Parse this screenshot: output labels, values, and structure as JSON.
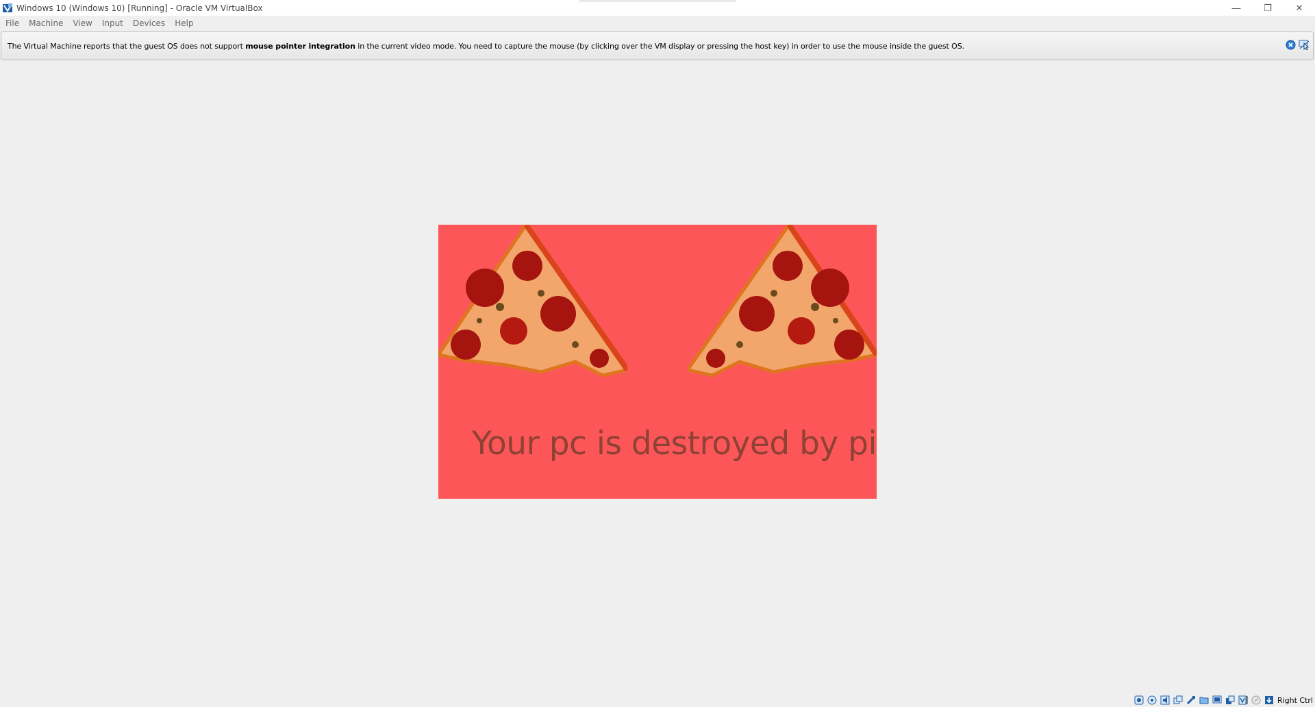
{
  "window": {
    "title": "Windows 10 (Windows 10) [Running] - Oracle VM VirtualBox",
    "minimize_glyph": "—",
    "restore_glyph": "❐",
    "close_glyph": "✕"
  },
  "menu": {
    "items": [
      "File",
      "Machine",
      "View",
      "Input",
      "Devices",
      "Help"
    ]
  },
  "notice": {
    "text_before": "The Virtual Machine reports that the guest OS does not support ",
    "text_bold": "mouse pointer integration",
    "text_after": " in the current video mode. You need to capture the mouse (by clicking over the VM display or pressing the host key) in order to use the mouse inside the guest OS.",
    "icons": [
      "close-notice-icon",
      "mouse-integration-icon"
    ]
  },
  "guest": {
    "background": "#fd5658",
    "message": "Your pc is destroyed by pizza",
    "message_color": "#8e4235"
  },
  "statusbar": {
    "icons": [
      "hard-disk-icon",
      "optical-drive-icon",
      "audio-icon",
      "network-icon",
      "usb-icon",
      "shared-folders-icon",
      "display-icon",
      "recording-icon",
      "cpu-icon",
      "mouse-capture-icon",
      "keyboard-capture-icon"
    ],
    "host_key": "Right Ctrl"
  }
}
